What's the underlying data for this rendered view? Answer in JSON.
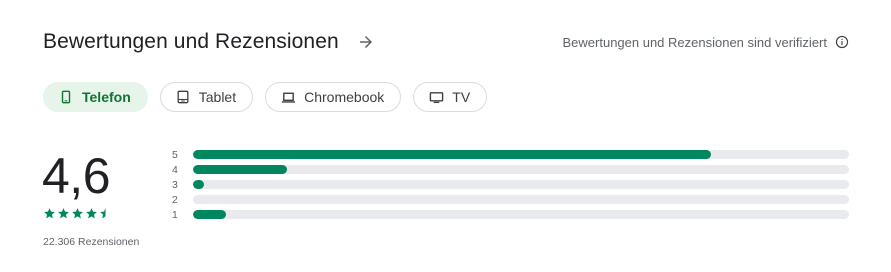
{
  "header": {
    "title": "Bewertungen und Rezensionen",
    "verified_text": "Bewertungen und Rezensionen sind verifiziert"
  },
  "device_chips": [
    {
      "label": "Telefon",
      "icon": "phone-icon",
      "selected": true
    },
    {
      "label": "Tablet",
      "icon": "tablet-icon",
      "selected": false
    },
    {
      "label": "Chromebook",
      "icon": "laptop-icon",
      "selected": false
    },
    {
      "label": "TV",
      "icon": "tv-icon",
      "selected": false
    }
  ],
  "summary": {
    "score": "4,6",
    "stars_filled": 4.5,
    "review_count": "22.306 Rezensionen"
  },
  "histogram": {
    "bars": [
      {
        "label": "5",
        "fraction": 0.79
      },
      {
        "label": "4",
        "fraction": 0.143
      },
      {
        "label": "3",
        "fraction": 0.017
      },
      {
        "label": "2",
        "fraction": 0.0
      },
      {
        "label": "1",
        "fraction": 0.051
      }
    ]
  },
  "colors": {
    "accent": "#01875f",
    "chip_active_bg": "#e6f4ea",
    "chip_active_text": "#137333",
    "track": "#e8eaed"
  }
}
